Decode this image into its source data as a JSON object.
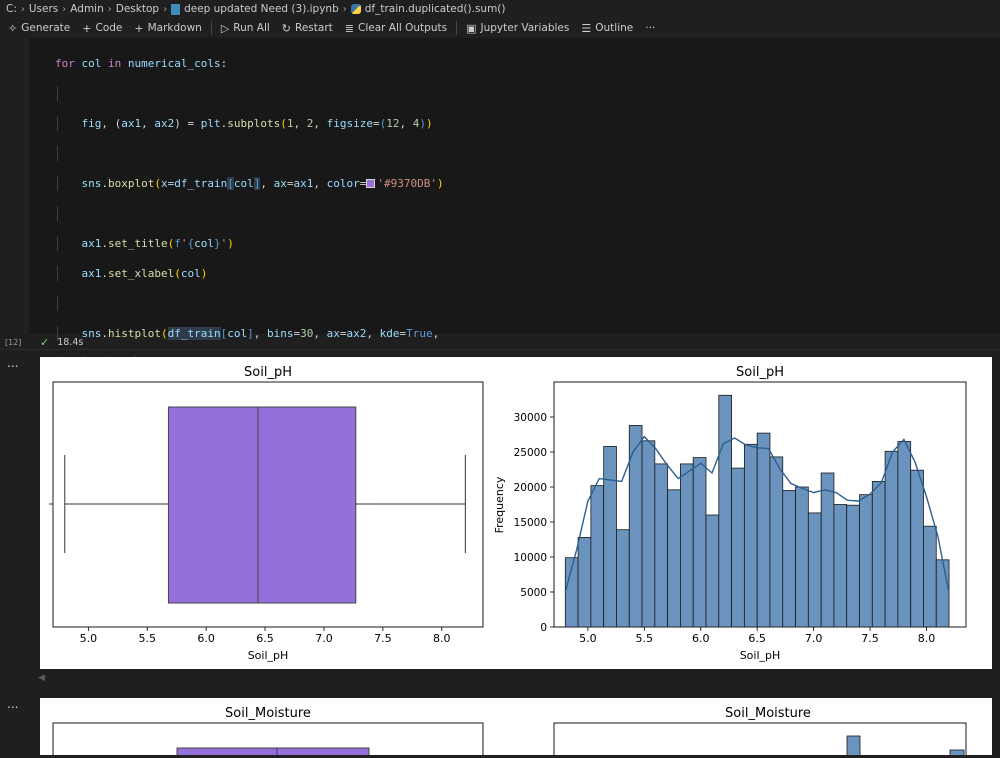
{
  "breadcrumb": {
    "items": [
      "C:",
      "Users",
      "Admin",
      "Desktop",
      "deep updated  Need (3).ipynb",
      "df_train.duplicated().sum()"
    ]
  },
  "toolbar": {
    "generate": "Generate",
    "code": "Code",
    "markdown": "Markdown",
    "run_all": "Run All",
    "restart": "Restart",
    "clear_outputs": "Clear All Outputs",
    "variables": "Jupyter Variables",
    "outline": "Outline",
    "more": "···"
  },
  "cell": {
    "exec_count": "[12]",
    "duration": "18.4s"
  },
  "output": {
    "dots": "..."
  },
  "colors": {
    "box_fill": "#9370DB",
    "hist_fill": "#6a93bd",
    "kde_line": "#2c5f91"
  },
  "chart_data": [
    {
      "type": "box",
      "title": "Soil_pH",
      "xlabel": "Soil_pH",
      "ylabel": "",
      "xlim": [
        4.7,
        8.35
      ],
      "xticks": [
        "5.0",
        "5.5",
        "6.0",
        "6.5",
        "7.0",
        "7.5",
        "8.0"
      ],
      "tick_values": [
        5.0,
        5.5,
        6.0,
        6.5,
        7.0,
        7.5,
        8.0
      ],
      "whisker_low": 4.8,
      "q1": 5.68,
      "median": 6.44,
      "q3": 7.27,
      "whisker_high": 8.2,
      "color": "#9370DB"
    },
    {
      "type": "histogram",
      "title": "Soil_pH",
      "xlabel": "Soil_pH",
      "ylabel": "Frequency",
      "xlim": [
        4.7,
        8.35
      ],
      "ylim": [
        0,
        35000
      ],
      "xticks": [
        "5.0",
        "5.5",
        "6.0",
        "6.5",
        "7.0",
        "7.5",
        "8.0"
      ],
      "xtick_values": [
        5.0,
        5.5,
        6.0,
        6.5,
        7.0,
        7.5,
        8.0
      ],
      "yticks": [
        "0",
        "5000",
        "10000",
        "15000",
        "20000",
        "25000",
        "30000"
      ],
      "ytick_values": [
        0,
        5000,
        10000,
        15000,
        20000,
        25000,
        30000
      ],
      "bin_start": 4.8,
      "bin_width": 0.11333,
      "values": [
        9900,
        12800,
        20200,
        25800,
        13900,
        28800,
        26600,
        23300,
        19600,
        23300,
        24200,
        16000,
        33100,
        22700,
        26100,
        27700,
        24300,
        19500,
        20000,
        16300,
        22000,
        17500,
        17400,
        18900,
        20800,
        25100,
        26500,
        22400,
        14400,
        9600
      ],
      "kde_x": [
        4.8,
        4.9,
        5.0,
        5.1,
        5.2,
        5.3,
        5.4,
        5.5,
        5.6,
        5.7,
        5.8,
        5.9,
        6.0,
        6.1,
        6.2,
        6.3,
        6.4,
        6.5,
        6.6,
        6.7,
        6.8,
        6.9,
        7.0,
        7.1,
        7.2,
        7.3,
        7.4,
        7.5,
        7.6,
        7.7,
        7.8,
        7.9,
        8.0,
        8.1,
        8.2
      ],
      "kde_y": [
        5000,
        11000,
        18000,
        21200,
        21000,
        20800,
        25000,
        27200,
        25500,
        23200,
        21200,
        22300,
        23400,
        22000,
        26200,
        27000,
        26000,
        25600,
        25500,
        22600,
        20500,
        19800,
        19200,
        19600,
        19200,
        18100,
        18000,
        19000,
        20600,
        25000,
        26800,
        23500,
        18600,
        13000,
        4800
      ],
      "color": "#6a93bd"
    },
    {
      "type": "box",
      "title": "Soil_Moisture"
    },
    {
      "type": "histogram",
      "title": "Soil_Moisture"
    }
  ]
}
